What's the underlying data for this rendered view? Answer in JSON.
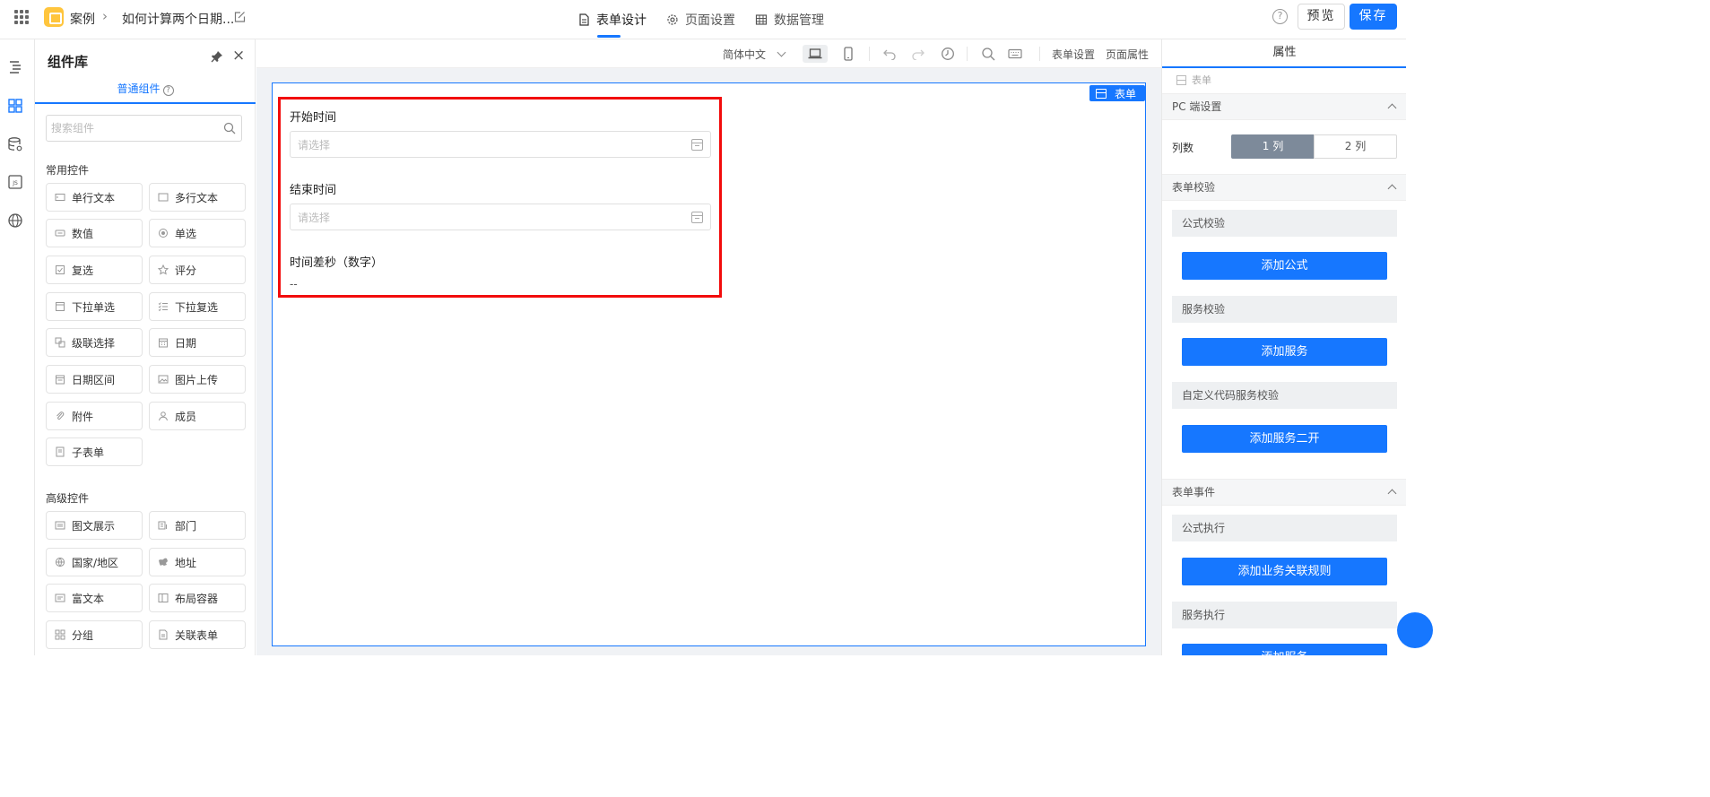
{
  "topbar": {
    "app_name": "案例",
    "page_name": "如何计算两个日期...",
    "tabs": [
      {
        "label": "表单设计",
        "icon": "file-icon",
        "active": true
      },
      {
        "label": "页面设置",
        "icon": "gear-icon",
        "active": false
      },
      {
        "label": "数据管理",
        "icon": "table-icon",
        "active": false
      }
    ],
    "preview_label": "预览",
    "save_label": "保存",
    "help_glyph": "?"
  },
  "library": {
    "title": "组件库",
    "tab_label": "普通组件",
    "search_placeholder": "搜索组件",
    "common_title": "常用控件",
    "common": [
      "单行文本",
      "多行文本",
      "数值",
      "单选",
      "复选",
      "评分",
      "下拉单选",
      "下拉复选",
      "级联选择",
      "日期",
      "日期区间",
      "图片上传",
      "附件",
      "成员",
      "子表单"
    ],
    "advanced_title": "高级控件",
    "advanced": [
      "图文展示",
      "部门",
      "国家/地区",
      "地址",
      "富文本",
      "布局容器",
      "分组",
      "关联表单"
    ]
  },
  "toolbar": {
    "language": "简体中文",
    "form_settings": "表单设置",
    "page_props": "页面属性"
  },
  "form": {
    "tag": "表单",
    "fields": [
      {
        "label": "开始时间",
        "placeholder": "请选择"
      },
      {
        "label": "结束时间",
        "placeholder": "请选择"
      }
    ],
    "calc_field": {
      "label": "时间差秒（数字）",
      "value": "--"
    }
  },
  "props": {
    "tab": "属性",
    "crumb": "表单",
    "pc_section": "PC 端设置",
    "cols_label": "列数",
    "col_options": [
      "1 列",
      "2 列"
    ],
    "col_selected": "1 列",
    "validate_section": "表单校验",
    "formula_validate": "公式校验",
    "add_formula": "添加公式",
    "service_validate": "服务校验",
    "add_service": "添加服务",
    "custom_validate": "自定义代码服务校验",
    "add_service_2": "添加服务二开",
    "event_section": "表单事件",
    "formula_exec": "公式执行",
    "add_rule": "添加业务关联规则",
    "service_exec": "服务执行",
    "add_service_exec": "添加服务"
  },
  "colors": {
    "accent": "#1677ff",
    "highlight": "#f20c0c",
    "logo": "#ffc53d"
  }
}
